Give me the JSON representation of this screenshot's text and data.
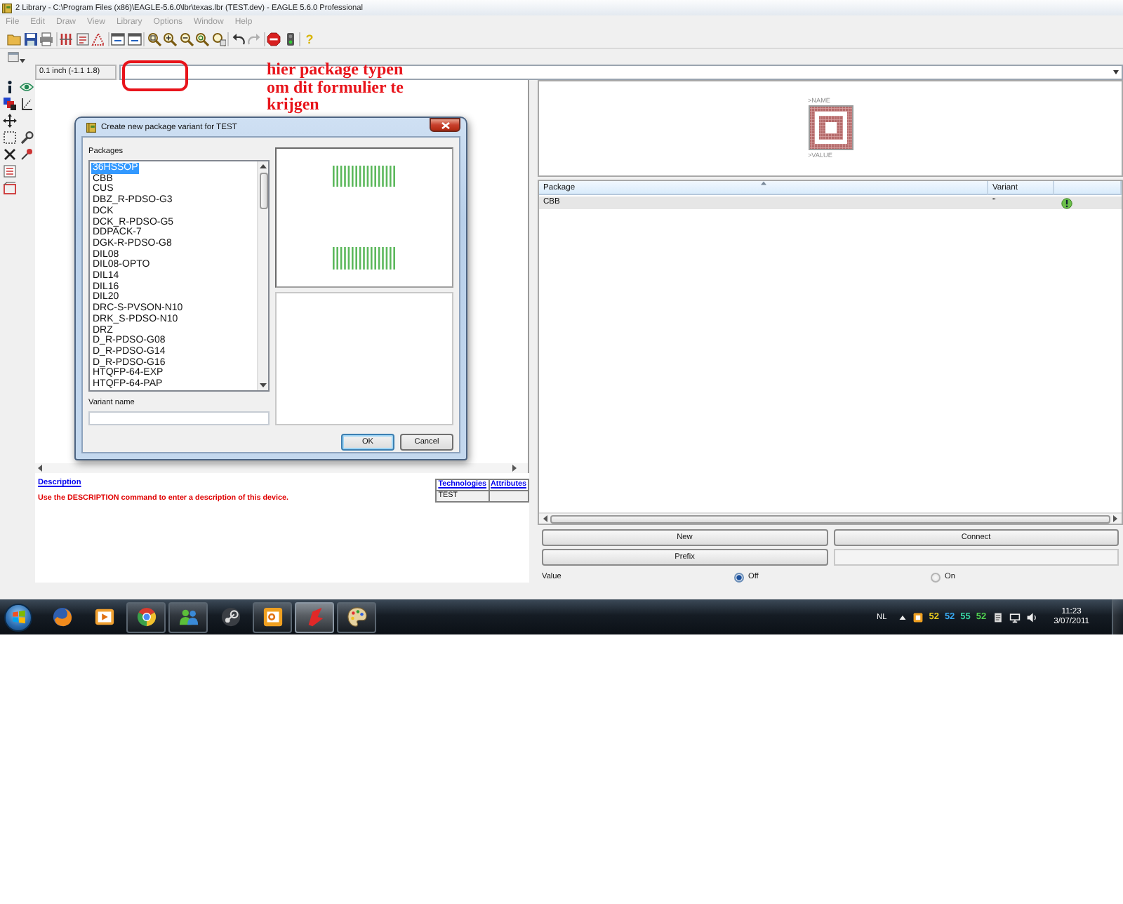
{
  "window": {
    "title": "2 Library - C:\\Program Files (x86)\\EAGLE-5.6.0\\lbr\\texas.lbr (TEST.dev) - EAGLE 5.6.0 Professional"
  },
  "menu": [
    {
      "label": "File",
      "disabled": true
    },
    {
      "label": "Edit",
      "disabled": true
    },
    {
      "label": "Draw",
      "disabled": true
    },
    {
      "label": "View",
      "disabled": true
    },
    {
      "label": "Library",
      "disabled": true
    },
    {
      "label": "Options",
      "disabled": true
    },
    {
      "label": "Window",
      "disabled": true
    },
    {
      "label": "Help",
      "disabled": true
    }
  ],
  "toolbar": {
    "undo": {
      "disabled": false
    },
    "redo": {
      "disabled": true
    },
    "help": "?"
  },
  "coordinates": {
    "value": "0.1 inch (-1.1 1.8)"
  },
  "annotation": {
    "text": "hier package typen om dit formulier te krijgen"
  },
  "dialog": {
    "title": "Create new package variant for TEST",
    "packages_label": "Packages",
    "packages": [
      {
        "name": "36HSSOP",
        "selected": true
      },
      {
        "name": "CBB",
        "selected": false
      },
      {
        "name": "CUS",
        "selected": false
      },
      {
        "name": "DBZ_R-PDSO-G3",
        "selected": false
      },
      {
        "name": "DCK",
        "selected": false
      },
      {
        "name": "DCK_R-PDSO-G5",
        "selected": false
      },
      {
        "name": "DDPACK-7",
        "selected": false
      },
      {
        "name": "DGK-R-PDSO-G8",
        "selected": false
      },
      {
        "name": "DIL08",
        "selected": false
      },
      {
        "name": "DIL08-OPTO",
        "selected": false
      },
      {
        "name": "DIL14",
        "selected": false
      },
      {
        "name": "DIL16",
        "selected": false
      },
      {
        "name": "DIL20",
        "selected": false
      },
      {
        "name": "DRC-S-PVSON-N10",
        "selected": false
      },
      {
        "name": "DRK_S-PDSO-N10",
        "selected": false
      },
      {
        "name": "DRZ",
        "selected": false
      },
      {
        "name": "D_R-PDSO-G08",
        "selected": false
      },
      {
        "name": "D_R-PDSO-G14",
        "selected": false
      },
      {
        "name": "D_R-PDSO-G16",
        "selected": false
      },
      {
        "name": "HTQFP-64-EXP",
        "selected": false
      },
      {
        "name": "HTQFP-64-PAP",
        "selected": false
      }
    ],
    "variant_label": "Variant name",
    "buttons": [
      {
        "label": "OK",
        "default": true
      },
      {
        "label": "Cancel",
        "default": false
      }
    ]
  },
  "description": {
    "heading": "Description",
    "text": "Use the DESCRIPTION command to enter a description of this device."
  },
  "technologies": {
    "columns": [
      "Technologies",
      "Attributes"
    ],
    "rows": [
      {
        "technology": "TEST"
      }
    ]
  },
  "symbol_preview": {
    "name_label": ">NAME",
    "value_label": ">VALUE"
  },
  "package_table": {
    "columns": [
      "Package",
      "Variant"
    ],
    "rows": [
      {
        "package": "CBB",
        "variant": "''",
        "selected": true
      }
    ]
  },
  "buttons": [
    "New",
    "Connect",
    "Prefix"
  ],
  "value_option": {
    "label": "Value",
    "options": [
      {
        "label": "Off",
        "selected": true
      },
      {
        "label": "On",
        "selected": false
      }
    ]
  },
  "taskbar": {
    "apps": [
      {
        "running": false,
        "selected": false
      },
      {
        "running": false,
        "selected": false
      },
      {
        "running": true,
        "selected": false
      },
      {
        "running": true,
        "selected": false
      },
      {
        "running": false,
        "selected": false
      },
      {
        "running": true,
        "selected": false
      },
      {
        "running": true,
        "selected": true
      },
      {
        "running": true,
        "selected": false
      }
    ],
    "tray": {
      "language": "NL",
      "readings": [
        {
          "text": "52",
          "color": "#e8c81e"
        },
        {
          "text": "52",
          "color": "#38a8f0"
        },
        {
          "text": "55",
          "color": "#38d0a0"
        },
        {
          "text": "52",
          "color": "#50d050"
        }
      ],
      "time": "11:23",
      "date": "3/07/2011"
    }
  }
}
